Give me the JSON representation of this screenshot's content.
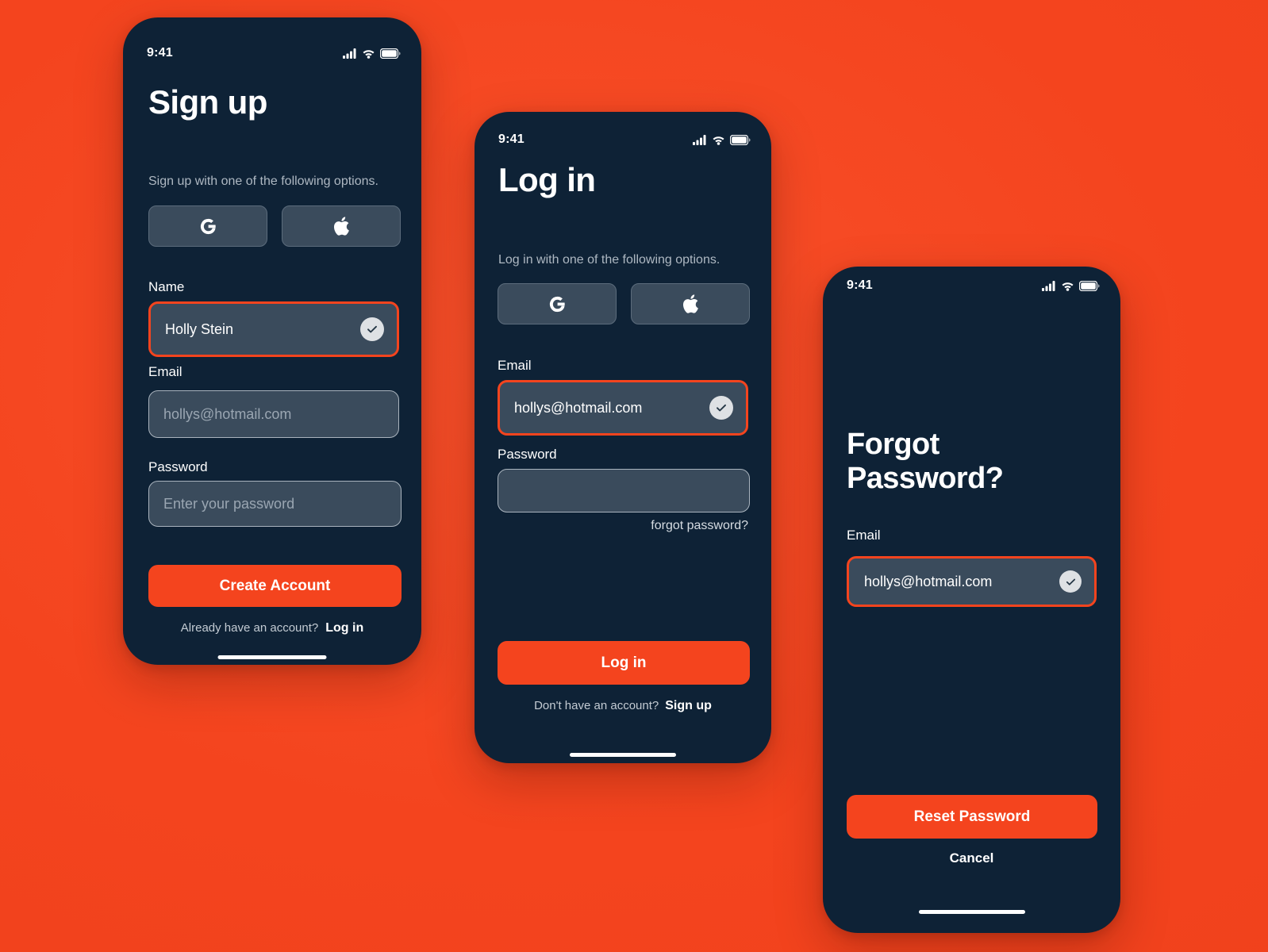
{
  "background_color": "#F4441E",
  "theme": {
    "accent": "#F4441E",
    "screen_bg": "#0E2236",
    "field_bg": "#3A4B5C",
    "field_border": "#AAB4BE",
    "muted_text": "#AEB8C2"
  },
  "screens": [
    {
      "id": "signup",
      "status_bar": {
        "time": "9:41",
        "cellular_icon": "cellular-signal-icon",
        "wifi_icon": "wifi-icon",
        "battery_icon": "battery-icon"
      },
      "title": "Sign up",
      "subtitle": "Sign up with one of the following options.",
      "social": [
        {
          "id": "google",
          "icon": "google-icon"
        },
        {
          "id": "apple",
          "icon": "apple-icon"
        }
      ],
      "fields": [
        {
          "id": "name",
          "label": "Name",
          "value": "Holly Stein",
          "placeholder": "",
          "state": "active",
          "valid_icon": "check-circle-icon"
        },
        {
          "id": "email",
          "label": "Email",
          "value": "",
          "placeholder": "hollys@hotmail.com",
          "state": "default",
          "valid_icon": ""
        },
        {
          "id": "password",
          "label": "Password",
          "value": "",
          "placeholder": "Enter your password",
          "state": "default",
          "valid_icon": ""
        }
      ],
      "primary_button": "Create Account",
      "footer": {
        "text": "Already have an account?",
        "link": "Log in"
      },
      "home_indicator": true
    },
    {
      "id": "login",
      "status_bar": {
        "time": "9:41",
        "cellular_icon": "cellular-signal-icon",
        "wifi_icon": "wifi-icon",
        "battery_icon": "battery-icon"
      },
      "title": "Log in",
      "subtitle": "Log in with one of the following options.",
      "social": [
        {
          "id": "google",
          "icon": "google-icon"
        },
        {
          "id": "apple",
          "icon": "apple-icon"
        }
      ],
      "fields": [
        {
          "id": "email",
          "label": "Email",
          "value": "hollys@hotmail.com",
          "placeholder": "",
          "state": "active",
          "valid_icon": "check-circle-icon"
        },
        {
          "id": "password",
          "label": "Password",
          "value": "",
          "placeholder": "",
          "state": "default",
          "valid_icon": ""
        }
      ],
      "forgot_link": "forgot password?",
      "primary_button": "Log in",
      "footer": {
        "text": "Don't have an account?",
        "link": "Sign up"
      },
      "home_indicator": true
    },
    {
      "id": "forgot",
      "status_bar": {
        "time": "9:41",
        "cellular_icon": "cellular-signal-icon",
        "wifi_icon": "wifi-icon",
        "battery_icon": "battery-icon"
      },
      "title": "Forgot\nPassword?",
      "title_line1": "Forgot",
      "title_line2": "Password?",
      "fields": [
        {
          "id": "email",
          "label": "Email",
          "value": "hollys@hotmail.com",
          "placeholder": "",
          "state": "active",
          "valid_icon": "check-circle-icon"
        }
      ],
      "primary_button": "Reset Password",
      "cancel_button": "Cancel",
      "home_indicator": true
    }
  ]
}
